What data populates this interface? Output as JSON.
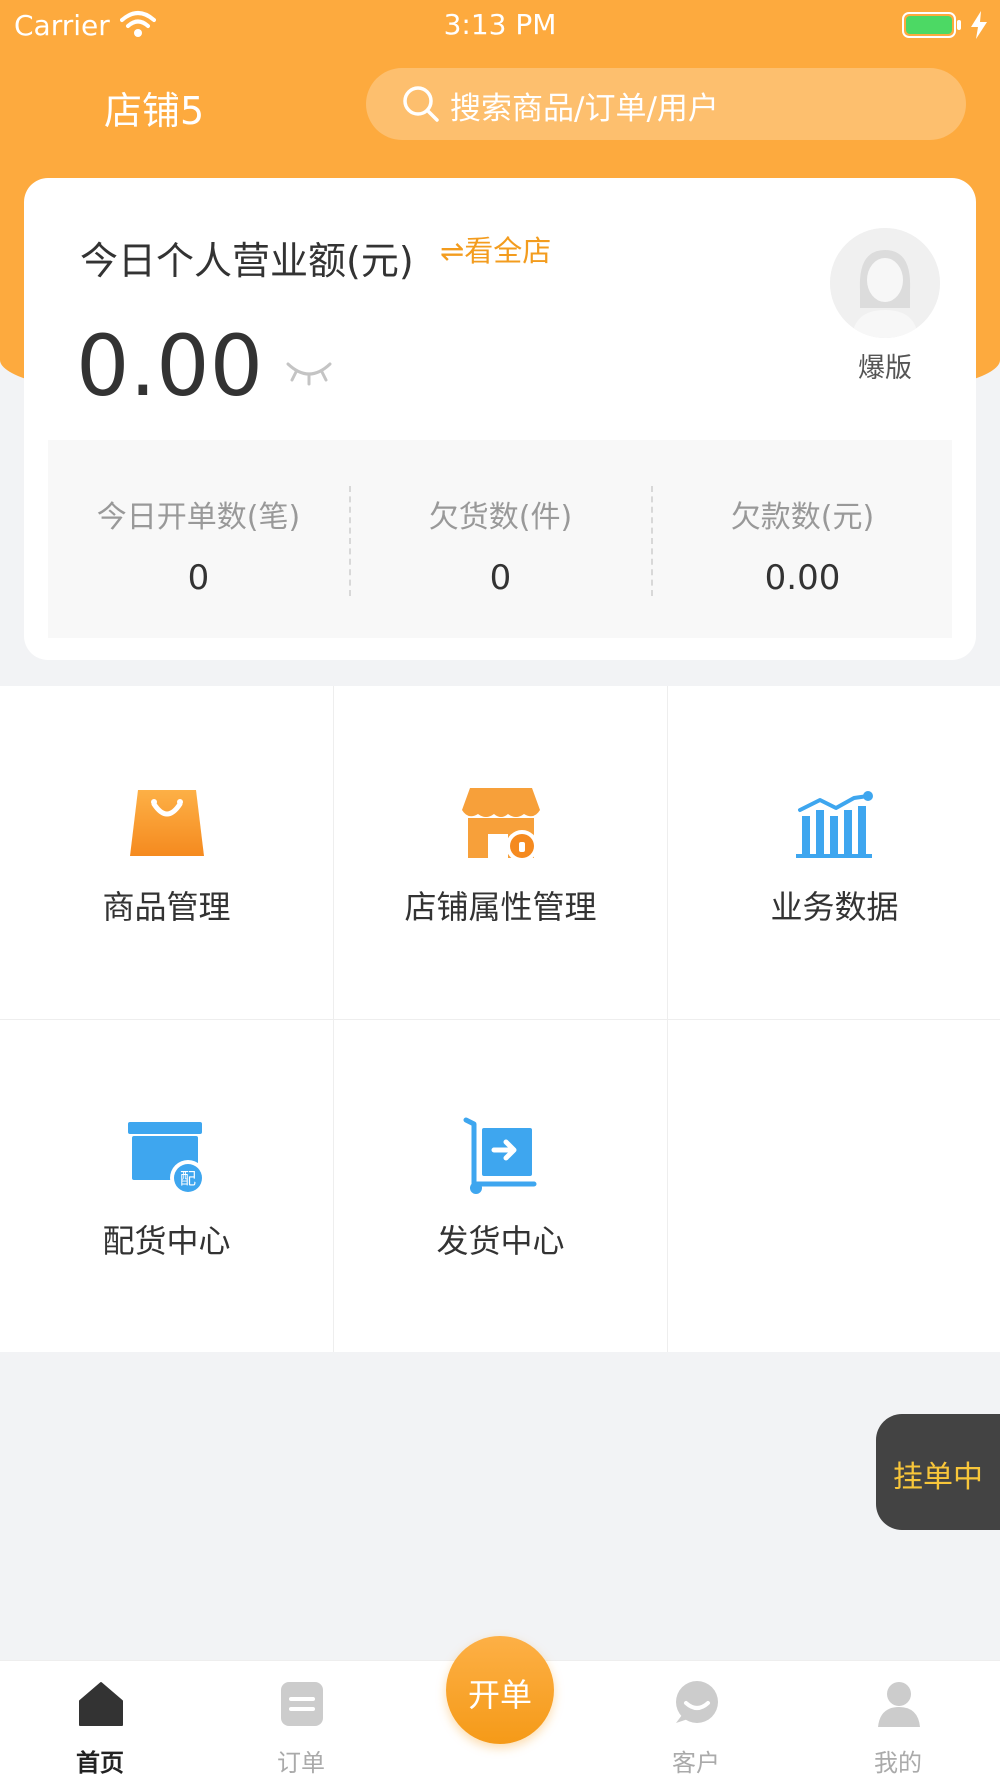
{
  "status_bar": {
    "carrier": "Carrier",
    "time": "3:13 PM"
  },
  "header": {
    "store_name": "店铺5",
    "search_placeholder": "搜索商品/订单/用户"
  },
  "summary": {
    "title": "今日个人营业额(元)",
    "view_all_label": "⇌看全店",
    "sales_value": "0.00",
    "avatar_label": "爆版",
    "stats": [
      {
        "label": "今日开单数(笔)",
        "value": "0"
      },
      {
        "label": "欠货数(件)",
        "value": "0"
      },
      {
        "label": "欠款数(元)",
        "value": "0.00"
      }
    ]
  },
  "grid": {
    "items": [
      {
        "label": "商品管理",
        "icon": "shopping-bag-icon"
      },
      {
        "label": "店铺属性管理",
        "icon": "store-lock-icon"
      },
      {
        "label": "业务数据",
        "icon": "bar-chart-icon"
      },
      {
        "label": "配货中心",
        "icon": "distribution-box-icon"
      },
      {
        "label": "发货中心",
        "icon": "shipping-cart-icon"
      }
    ]
  },
  "pending": {
    "label": "挂单中"
  },
  "bottom_nav": {
    "items": [
      {
        "label": "首页",
        "icon": "home-icon",
        "active": true
      },
      {
        "label": "订单",
        "icon": "order-icon",
        "active": false
      },
      {
        "label": "客户",
        "icon": "customer-icon",
        "active": false
      },
      {
        "label": "我的",
        "icon": "profile-icon",
        "active": false
      }
    ],
    "fab_label": "开单"
  },
  "colors": {
    "brand_orange": "#fdaa3e",
    "accent_orange": "#f39c1e",
    "blue_icon": "#3ea6ef",
    "pending_text": "#f8c63a"
  }
}
